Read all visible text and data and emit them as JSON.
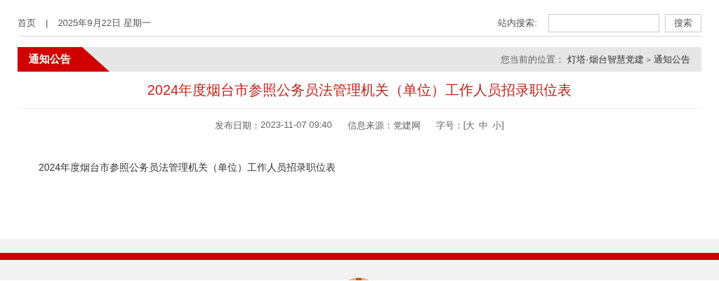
{
  "top_bar": {
    "home_link": "首页",
    "separator": "|",
    "date": "2025年9月22日 星期一",
    "search_label": "站内搜索:",
    "search_button": "搜索"
  },
  "section_bar": {
    "title": "通知公告",
    "location_label": "您当前的位置：",
    "breadcrumb": [
      "灯塔·烟台智慧党建",
      "通知公告"
    ],
    "breadcrumb_separator": ">"
  },
  "article": {
    "title": "2024年度烟台市参照公务员法管理机关（单位）工作人员招录职位表",
    "meta": [
      {
        "label": "发布日期：",
        "value": "2023-11-07 09:40"
      },
      {
        "label": "信息来源：",
        "value": "党建网"
      }
    ],
    "font_size": {
      "label": "字号：",
      "open": "[",
      "options": [
        "大",
        "中",
        "小"
      ],
      "close": "]"
    },
    "body": "2024年度烟台市参照公务员法管理机关（单位）工作人员招录职位表"
  }
}
